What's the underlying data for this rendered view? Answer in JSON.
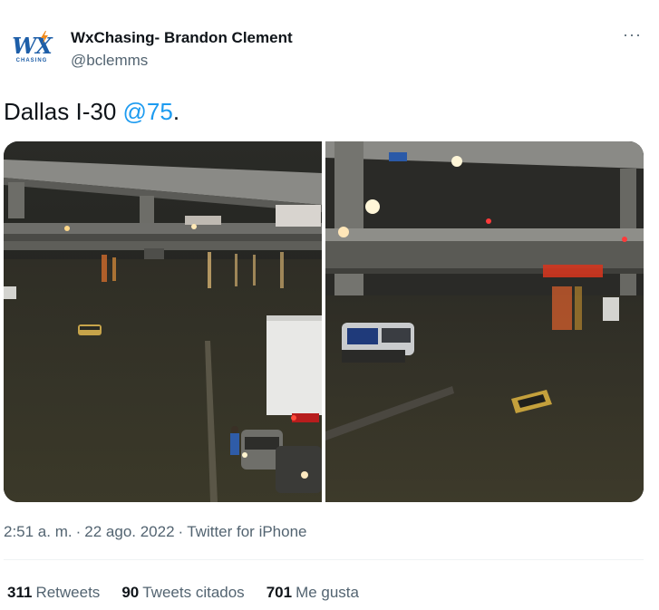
{
  "author": {
    "avatar_text": "WX",
    "avatar_subtext": "CHASING",
    "name": "WxChasing- Brandon Clement",
    "handle": "@bclemms"
  },
  "more_icon": "more-dots-icon",
  "tweet": {
    "text_prefix": "Dallas I-30 ",
    "mention": "@75",
    "text_suffix": "."
  },
  "meta": {
    "time": "2:51 a. m.",
    "sep1": "·",
    "date": "22 ago. 2022",
    "sep2": "·",
    "source": "Twitter for iPhone"
  },
  "stats": [
    {
      "count": "311",
      "label": "Retweets"
    },
    {
      "count": "90",
      "label": "Tweets citados"
    },
    {
      "count": "701",
      "label": "Me gusta"
    }
  ],
  "colors": {
    "text": "#0f1419",
    "secondary": "#536471",
    "link": "#1d9bf0",
    "brand_blue": "#1d5ea8",
    "brand_orange": "#f08a1c"
  }
}
